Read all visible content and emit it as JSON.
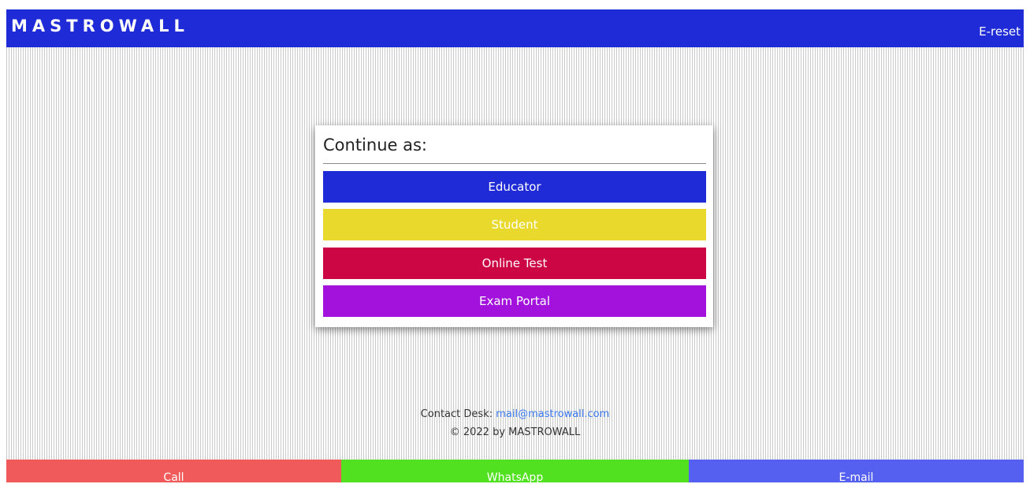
{
  "header": {
    "brand": "MASTROWALL",
    "reset_label": "E-reset",
    "bg_color": "#1f2bd6"
  },
  "card": {
    "title": "Continue as:",
    "options": [
      {
        "label": "Educator",
        "color": "#1f2bd6"
      },
      {
        "label": "Student",
        "color": "#e9d92c"
      },
      {
        "label": "Online Test",
        "color": "#cc0645"
      },
      {
        "label": "Exam Portal",
        "color": "#a212dc"
      }
    ]
  },
  "footer": {
    "contact_label": "Contact Desk:",
    "contact_email": "mail@mastrowall.com",
    "copyright": "© 2022 by MASTROWALL"
  },
  "bottom_bar": [
    {
      "label": "Call",
      "color": "#f05a5a"
    },
    {
      "label": "WhatsApp",
      "color": "#52e120"
    },
    {
      "label": "E-mail",
      "color": "#5560f0"
    }
  ]
}
